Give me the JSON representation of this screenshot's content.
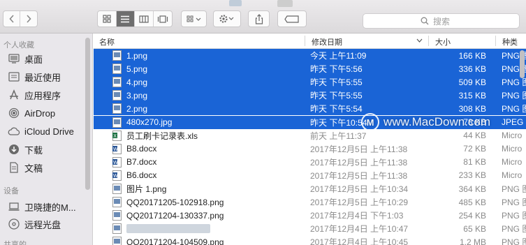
{
  "toolbar": {
    "search_placeholder": "搜索"
  },
  "sidebar": {
    "section_favorites": "个人收藏",
    "favorites": [
      {
        "label": "桌面",
        "icon": "desktop-icon"
      },
      {
        "label": "最近使用",
        "icon": "recents-icon"
      },
      {
        "label": "应用程序",
        "icon": "applications-icon"
      },
      {
        "label": "AirDrop",
        "icon": "airdrop-icon"
      },
      {
        "label": "iCloud Drive",
        "icon": "cloud-icon"
      },
      {
        "label": "下载",
        "icon": "download-icon"
      },
      {
        "label": "文稿",
        "icon": "document-icon"
      }
    ],
    "section_devices": "设备",
    "devices": [
      {
        "label": "卫晓捷的M...",
        "icon": "computer-icon"
      },
      {
        "label": "远程光盘",
        "icon": "disc-icon"
      }
    ],
    "section_shared": "共享的"
  },
  "columns": {
    "name": "名称",
    "date": "修改日期",
    "size": "大小",
    "kind": "种类"
  },
  "files": [
    {
      "name": "1.png",
      "date": "今天 上午11:09",
      "size": "166 KB",
      "kind": "PNG 图",
      "selected": true,
      "icon": "image-file-icon"
    },
    {
      "name": "5.png",
      "date": "昨天 下午5:56",
      "size": "336 KB",
      "kind": "PNG 图",
      "selected": true,
      "icon": "image-file-icon"
    },
    {
      "name": "4.png",
      "date": "昨天 下午5:55",
      "size": "509 KB",
      "kind": "PNG 图",
      "selected": true,
      "icon": "image-file-icon"
    },
    {
      "name": "3.png",
      "date": "昨天 下午5:55",
      "size": "315 KB",
      "kind": "PNG 图",
      "selected": true,
      "icon": "image-file-icon"
    },
    {
      "name": "2.png",
      "date": "昨天 下午5:54",
      "size": "308 KB",
      "kind": "PNG 图",
      "selected": true,
      "icon": "image-file-icon"
    },
    {
      "name": "480x270.jpg",
      "date": "昨天 下午10:54",
      "size": "78 KB",
      "kind": "JPEG",
      "selected": true,
      "icon": "image-file-icon"
    },
    {
      "name": "员工刷卡记录表.xls",
      "date": "前天 上午11:37",
      "size": "44 KB",
      "kind": "Micro",
      "selected": false,
      "icon": "excel-file-icon"
    },
    {
      "name": "B8.docx",
      "date": "2017年12月5日 上午11:38",
      "size": "72 KB",
      "kind": "Micro",
      "selected": false,
      "icon": "word-file-icon"
    },
    {
      "name": "B7.docx",
      "date": "2017年12月5日 上午11:38",
      "size": "81 KB",
      "kind": "Micro",
      "selected": false,
      "icon": "word-file-icon"
    },
    {
      "name": "B6.docx",
      "date": "2017年12月5日 上午11:38",
      "size": "233 KB",
      "kind": "Micro",
      "selected": false,
      "icon": "word-file-icon"
    },
    {
      "name": "图片 1.png",
      "date": "2017年12月5日 上午10:34",
      "size": "364 KB",
      "kind": "PNG 图",
      "selected": false,
      "icon": "image-file-icon"
    },
    {
      "name": "QQ20171205-102918.png",
      "date": "2017年12月5日 上午10:29",
      "size": "485 KB",
      "kind": "PNG 图",
      "selected": false,
      "icon": "image-file-icon"
    },
    {
      "name": "QQ20171204-130337.png",
      "date": "2017年12月4日 下午1:03",
      "size": "254 KB",
      "kind": "PNG 图",
      "selected": false,
      "icon": "image-file-icon"
    },
    {
      "name": "",
      "date": "2017年12月4日 上午10:47",
      "size": "65 KB",
      "kind": "PNG 图",
      "selected": false,
      "icon": "image-file-icon"
    },
    {
      "name": "QQ20171204-104509.png",
      "date": "2017年12月4日 上午10:45",
      "size": "1.2 MB",
      "kind": "PNG 图",
      "selected": false,
      "icon": "image-file-icon"
    }
  ],
  "watermark": "www.MacDown.com",
  "colors": {
    "selection": "#1a64d6",
    "sidebar": "#e9e7eb"
  }
}
